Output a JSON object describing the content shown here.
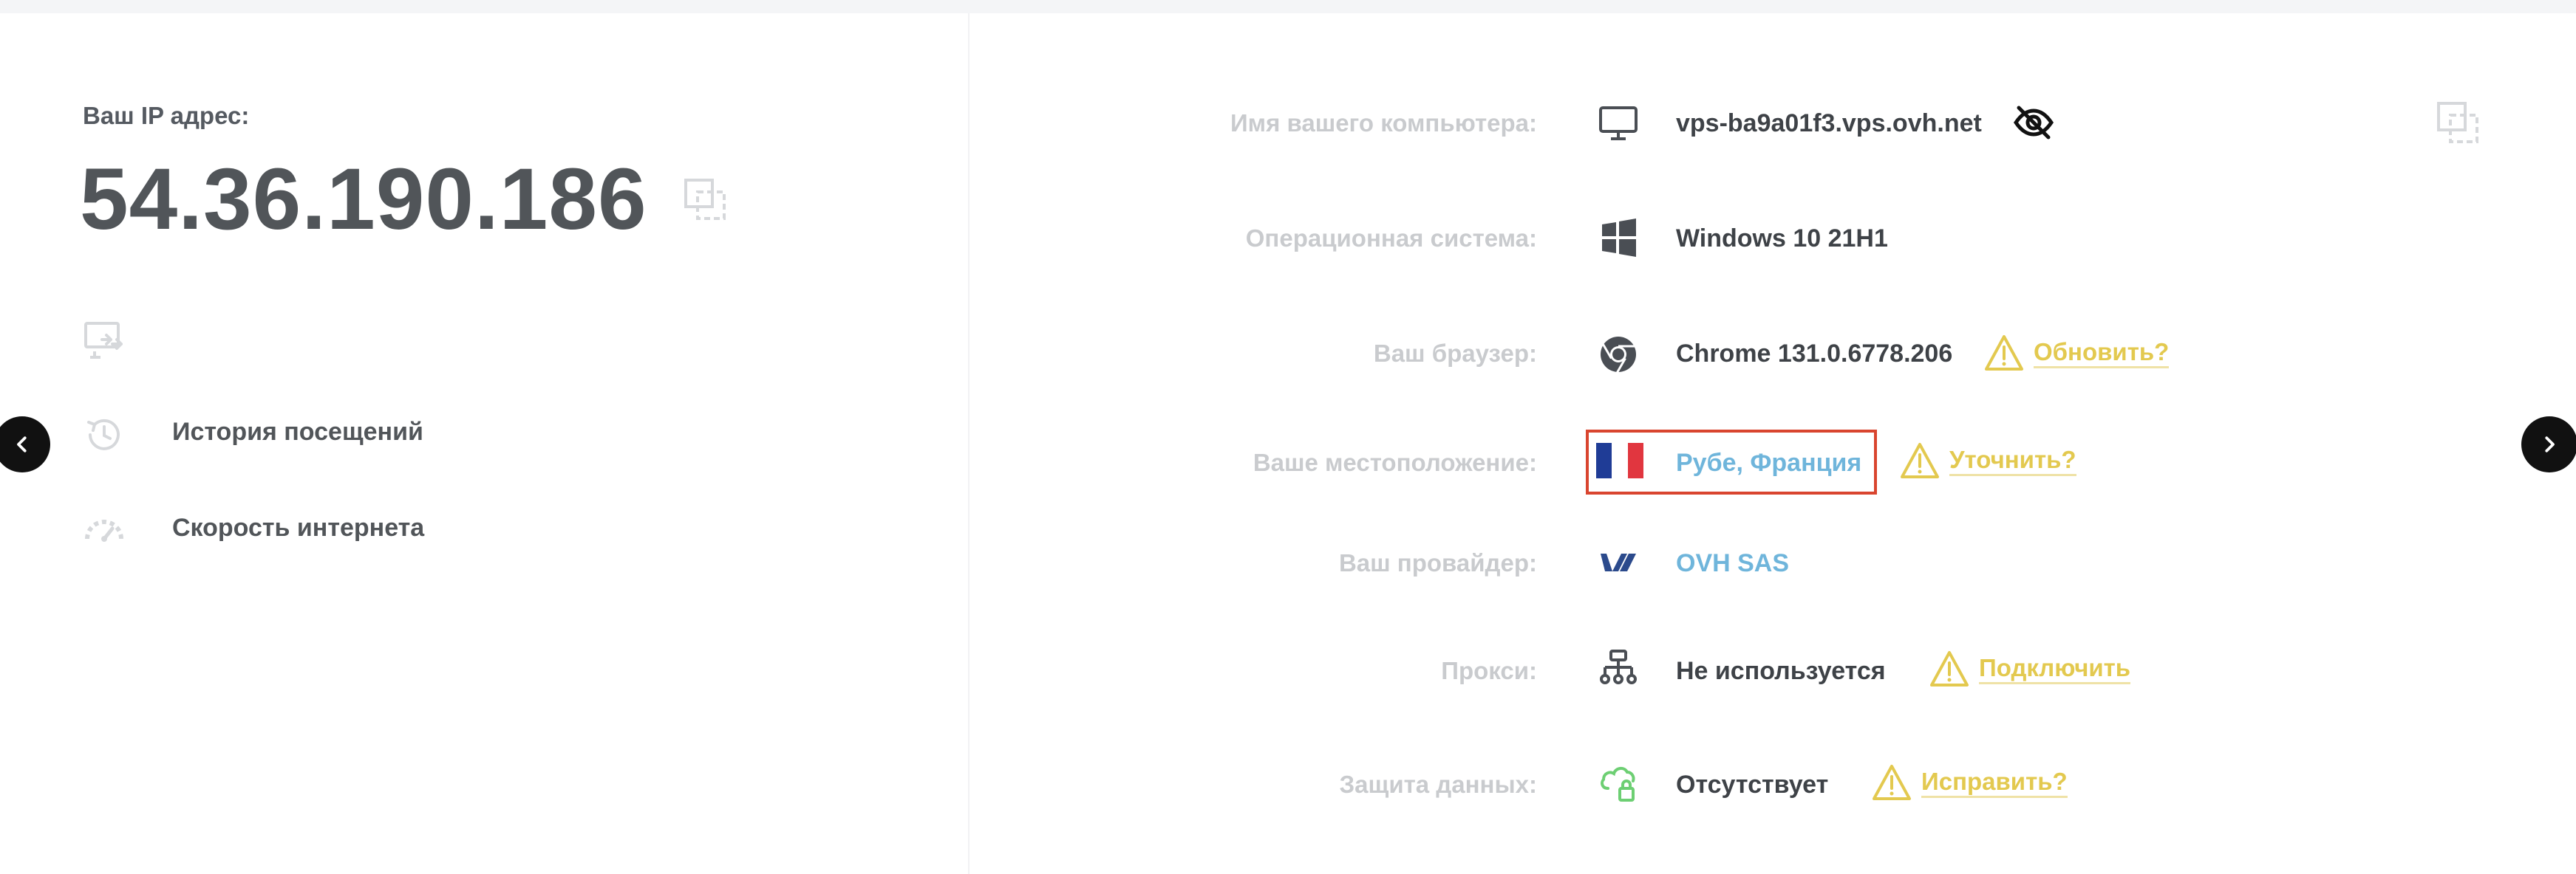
{
  "ip": {
    "label": "Ваш IP адрес:",
    "value": "54.36.190.186"
  },
  "left_links": [
    {
      "label": "История посещений",
      "icon": "history-icon"
    },
    {
      "label": "Скорость интернета",
      "icon": "speedometer-icon"
    }
  ],
  "rows": {
    "computer": {
      "label": "Имя вашего компьютера:",
      "value": "vps-ba9a01f3.vps.ovh.net",
      "icon": "monitor-icon"
    },
    "os": {
      "label": "Операционная система:",
      "value": "Windows 10 21H1",
      "icon": "windows-icon"
    },
    "browser": {
      "label": "Ваш браузер:",
      "value": "Chrome 131.0.6778.206",
      "icon": "chrome-icon",
      "action": "Обновить?"
    },
    "location": {
      "label": "Ваше местоположение:",
      "value": "Рубе, Франция",
      "icon": "france-flag-icon",
      "action": "Уточнить?"
    },
    "provider": {
      "label": "Ваш провайдер:",
      "value": "OVH SAS",
      "icon": "ovh-logo-icon"
    },
    "proxy": {
      "label": "Прокси:",
      "value": "Не используется",
      "icon": "network-icon",
      "action": "Подключить"
    },
    "protection": {
      "label": "Защита данных:",
      "value": "Отсутствует",
      "icon": "cloud-lock-icon",
      "action": "Исправить?"
    }
  },
  "colors": {
    "warning": "#e3c94f",
    "link_blue": "#6fb5db",
    "highlight_border": "#d9452f",
    "label_gray": "#c9cbce"
  }
}
